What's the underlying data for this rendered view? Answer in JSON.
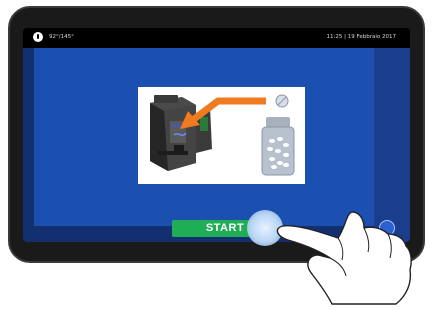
{
  "status_bar": {
    "temperature": "92°/145°",
    "datetime": "11:25 | 19 Febbraio 2017"
  },
  "main": {
    "start_label": "START"
  },
  "icons": {
    "temperature": "thermometer-icon",
    "round_button": "circle-icon",
    "hand": "pointing-hand-icon"
  },
  "colors": {
    "screen_blue": "#1b4fb0",
    "start_green": "#1fae55",
    "arrow_orange": "#f07a20"
  }
}
